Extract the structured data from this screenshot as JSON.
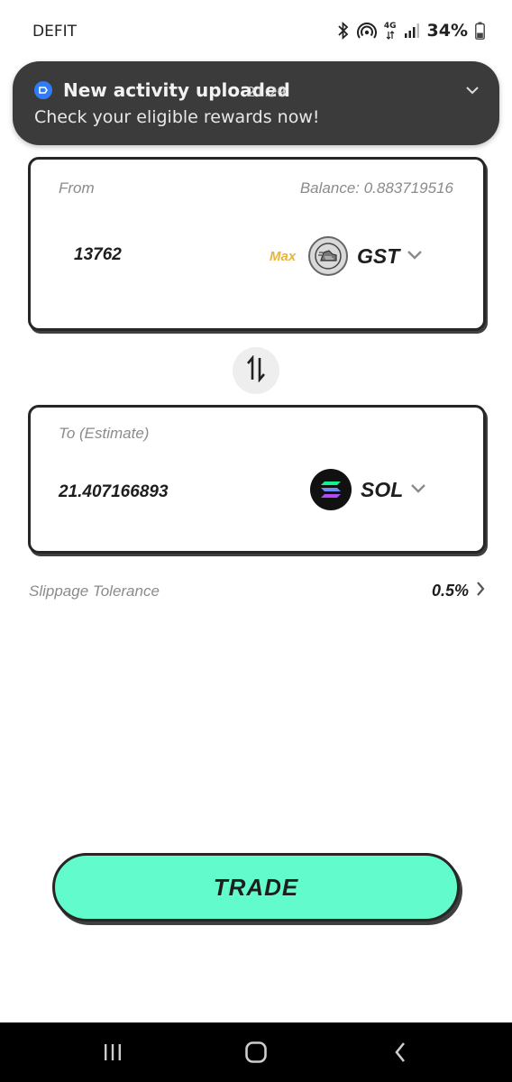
{
  "status_bar": {
    "app_name": "DEFIT",
    "network_label": "4G",
    "battery_percent": "34%",
    "icons": [
      "bluetooth-icon",
      "hotspot-icon",
      "network-4g-icon",
      "signal-icon",
      "battery-icon"
    ]
  },
  "notification": {
    "title": "New activity uploaded",
    "time": "21:29",
    "body": "Check your eligible rewards now!",
    "app_icon": "app-icon",
    "accent_color": "#2f7cf6"
  },
  "from_card": {
    "label": "From",
    "balance": "Balance: 0.883719516",
    "amount": "13762",
    "max_label": "Max",
    "token_symbol": "GST",
    "token_icon": "gst-token-icon"
  },
  "swap": {
    "icon": "swap-arrows-icon"
  },
  "to_card": {
    "label": "To (Estimate)",
    "amount": "21.407166893",
    "token_symbol": "SOL",
    "token_icon": "sol-token-icon"
  },
  "slippage": {
    "label": "Slippage Tolerance",
    "value": "0.5%"
  },
  "trade_button": {
    "label": "TRADE",
    "color": "#62fbcb"
  },
  "nav_bar": {
    "items": [
      "recents-icon",
      "home-icon",
      "back-icon"
    ]
  }
}
